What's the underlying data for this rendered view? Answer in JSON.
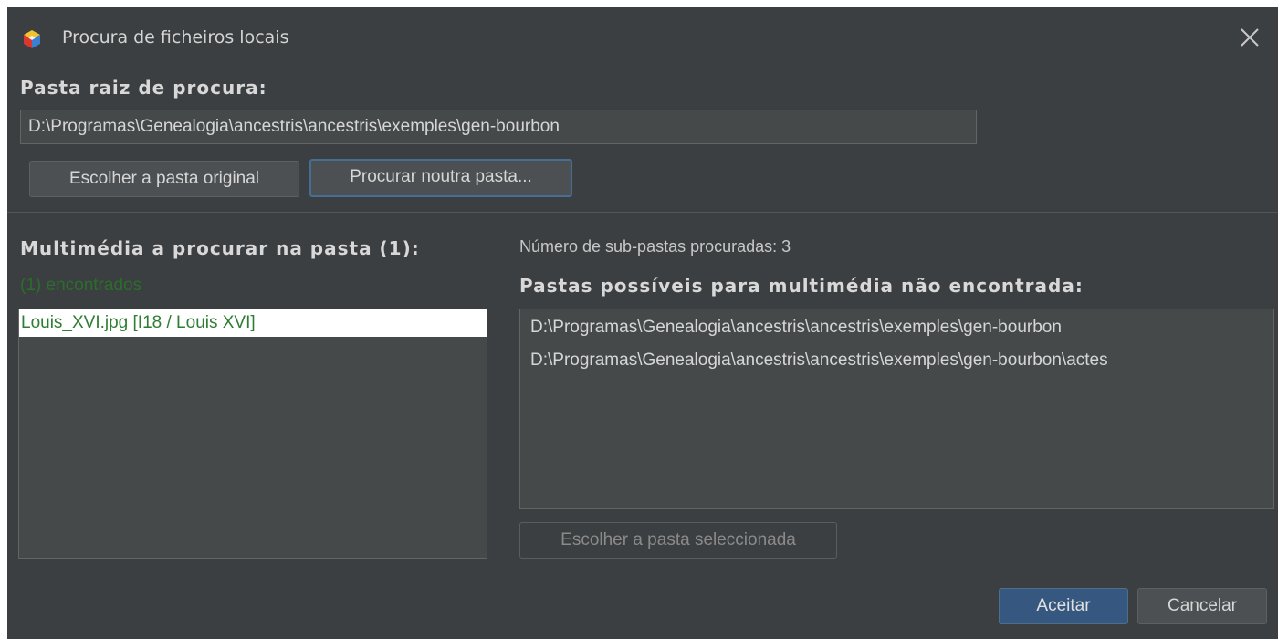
{
  "window": {
    "title": "Procura de ficheiros locais"
  },
  "root_folder": {
    "heading": "Pasta raiz de procura:",
    "path_value": "D:\\Programas\\Genealogia\\ancestris\\ancestris\\exemples\\gen-bourbon",
    "choose_original_label": "Escolher a pasta original",
    "search_other_label": "Procurar noutra pasta..."
  },
  "media": {
    "heading": "Multimédia a procurar na pasta (1):",
    "found_label": "(1) encontrados",
    "items": [
      {
        "label": "Louis_XVI.jpg   [I18 / Louis XVI]",
        "selected": true
      }
    ]
  },
  "folders": {
    "subfolders_count_label": "Número de sub-pastas procuradas: 3",
    "heading": "Pastas possíveis para multimédia não encontrada:",
    "items": [
      "D:\\Programas\\Genealogia\\ancestris\\ancestris\\exemples\\gen-bourbon",
      "D:\\Programas\\Genealogia\\ancestris\\ancestris\\exemples\\gen-bourbon\\actes"
    ],
    "choose_selected_label": "Escolher a pasta seleccionada"
  },
  "footer": {
    "accept_label": "Aceitar",
    "cancel_label": "Cancelar"
  },
  "colors": {
    "background": "#3c3f41",
    "found_text": "#2a6e2a",
    "primary_button": "#365880"
  },
  "icons": {
    "app": "ancestris-cube-icon",
    "close": "close-icon"
  }
}
